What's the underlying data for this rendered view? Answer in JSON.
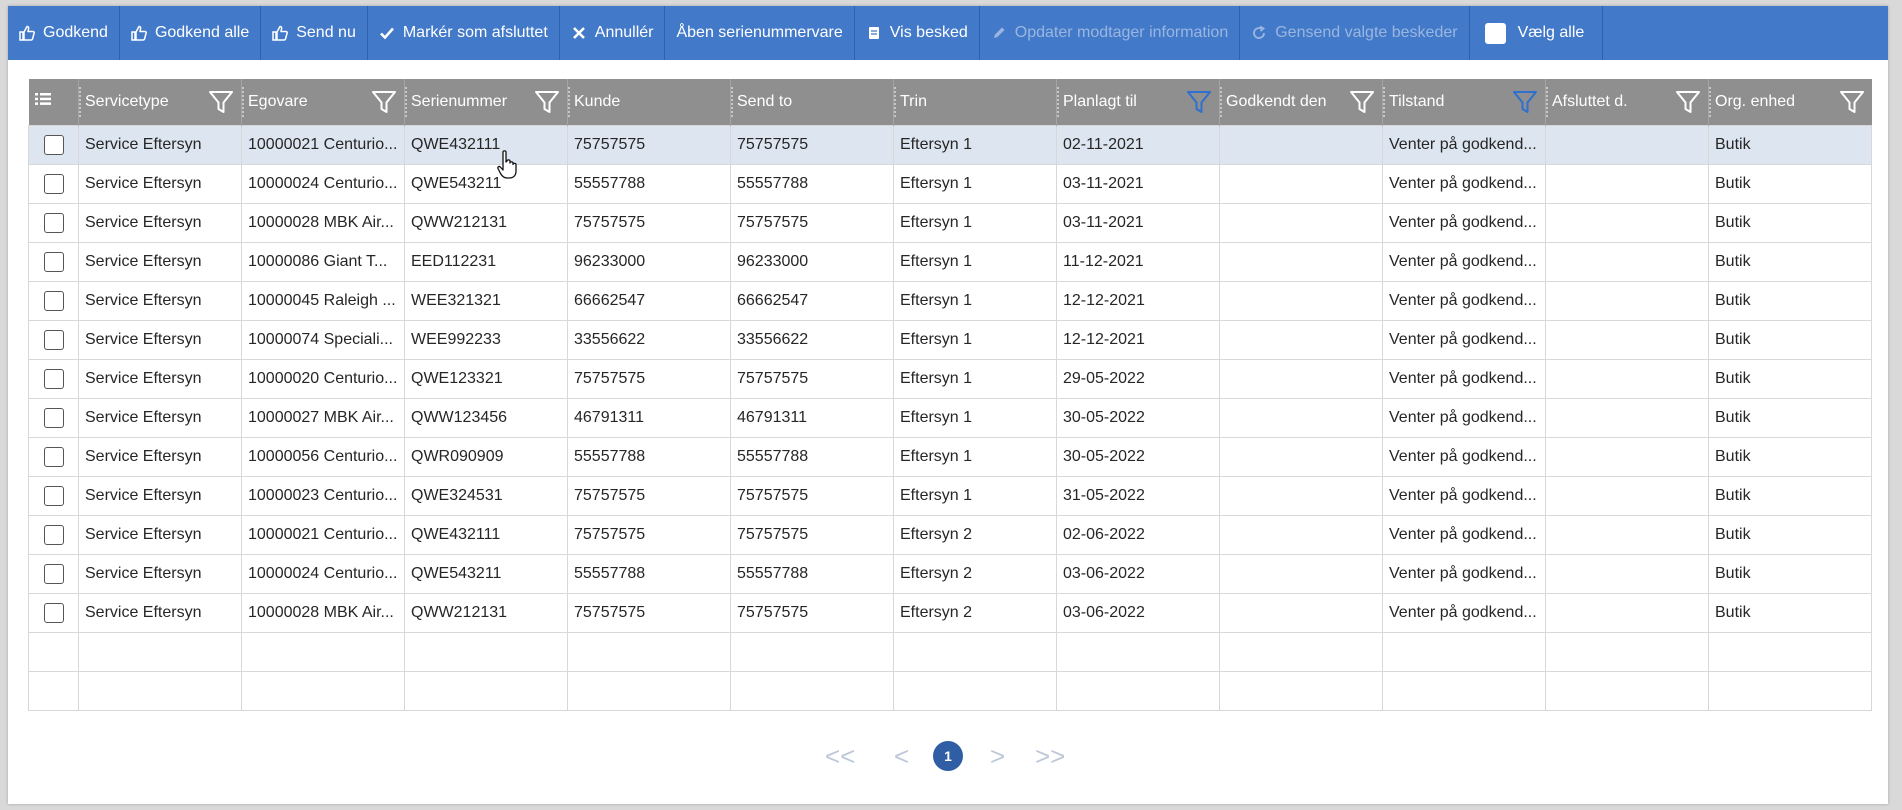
{
  "toolbar": {
    "buttons": [
      {
        "label": "Godkend",
        "icon": "thumbs-up-icon",
        "disabled": false
      },
      {
        "label": "Godkend alle",
        "icon": "thumbs-up-icon",
        "disabled": false
      },
      {
        "label": "Send nu",
        "icon": "thumbs-up-icon",
        "disabled": false
      },
      {
        "label": "Markér som afsluttet",
        "icon": "check-icon",
        "disabled": false
      },
      {
        "label": "Annullér",
        "icon": "x-icon",
        "disabled": false
      },
      {
        "label": "Åben serienummervare",
        "icon": "",
        "disabled": false
      },
      {
        "label": "Vis besked",
        "icon": "message-icon",
        "disabled": false
      },
      {
        "label": "Opdater modtager information",
        "icon": "pencil-icon",
        "disabled": true
      },
      {
        "label": "Gensend valgte beskeder",
        "icon": "refresh-icon",
        "disabled": true
      }
    ],
    "select_all_label": "Vælg alle"
  },
  "grid": {
    "columns": [
      {
        "label": "",
        "icon": "list-icon"
      },
      {
        "label": "Servicetype",
        "filter": true,
        "filter_active": false
      },
      {
        "label": "Egovare",
        "filter": true,
        "filter_active": false
      },
      {
        "label": "Serienummer",
        "filter": true,
        "filter_active": false
      },
      {
        "label": "Kunde",
        "filter": false
      },
      {
        "label": "Send to",
        "filter": false
      },
      {
        "label": "Trin",
        "filter": false
      },
      {
        "label": "Planlagt til",
        "filter": true,
        "filter_active": true
      },
      {
        "label": "Godkendt den",
        "filter": true,
        "filter_active": false
      },
      {
        "label": "Tilstand",
        "filter": true,
        "filter_active": true
      },
      {
        "label": "Afsluttet d.",
        "filter": true,
        "filter_active": false
      },
      {
        "label": "Org. enhed",
        "filter": true,
        "filter_active": false
      }
    ],
    "rows": [
      [
        "Service Eftersyn",
        "10000021 Centurio...",
        "QWE432111",
        "75757575",
        "75757575",
        "Eftersyn 1",
        "02-11-2021",
        "",
        "Venter på godkend...",
        "",
        "Butik"
      ],
      [
        "Service Eftersyn",
        "10000024 Centurio...",
        "QWE543211",
        "55557788",
        "55557788",
        "Eftersyn 1",
        "03-11-2021",
        "",
        "Venter på godkend...",
        "",
        "Butik"
      ],
      [
        "Service Eftersyn",
        "10000028 MBK Air...",
        "QWW212131",
        "75757575",
        "75757575",
        "Eftersyn 1",
        "03-11-2021",
        "",
        "Venter på godkend...",
        "",
        "Butik"
      ],
      [
        "Service Eftersyn",
        "10000086 Giant T...",
        "EED112231",
        "96233000",
        "96233000",
        "Eftersyn 1",
        "11-12-2021",
        "",
        "Venter på godkend...",
        "",
        "Butik"
      ],
      [
        "Service Eftersyn",
        "10000045 Raleigh ...",
        "WEE321321",
        "66662547",
        "66662547",
        "Eftersyn 1",
        "12-12-2021",
        "",
        "Venter på godkend...",
        "",
        "Butik"
      ],
      [
        "Service Eftersyn",
        "10000074 Speciali...",
        "WEE992233",
        "33556622",
        "33556622",
        "Eftersyn 1",
        "12-12-2021",
        "",
        "Venter på godkend...",
        "",
        "Butik"
      ],
      [
        "Service Eftersyn",
        "10000020 Centurio...",
        "QWE123321",
        "75757575",
        "75757575",
        "Eftersyn 1",
        "29-05-2022",
        "",
        "Venter på godkend...",
        "",
        "Butik"
      ],
      [
        "Service Eftersyn",
        "10000027 MBK Air...",
        "QWW123456",
        "46791311",
        "46791311",
        "Eftersyn 1",
        "30-05-2022",
        "",
        "Venter på godkend...",
        "",
        "Butik"
      ],
      [
        "Service Eftersyn",
        "10000056 Centurio...",
        "QWR090909",
        "55557788",
        "55557788",
        "Eftersyn 1",
        "30-05-2022",
        "",
        "Venter på godkend...",
        "",
        "Butik"
      ],
      [
        "Service Eftersyn",
        "10000023 Centurio...",
        "QWE324531",
        "75757575",
        "75757575",
        "Eftersyn 1",
        "31-05-2022",
        "",
        "Venter på godkend...",
        "",
        "Butik"
      ],
      [
        "Service Eftersyn",
        "10000021 Centurio...",
        "QWE432111",
        "75757575",
        "75757575",
        "Eftersyn 2",
        "02-06-2022",
        "",
        "Venter på godkend...",
        "",
        "Butik"
      ],
      [
        "Service Eftersyn",
        "10000024 Centurio...",
        "QWE543211",
        "55557788",
        "55557788",
        "Eftersyn 2",
        "03-06-2022",
        "",
        "Venter på godkend...",
        "",
        "Butik"
      ],
      [
        "Service Eftersyn",
        "10000028 MBK Air...",
        "QWW212131",
        "75757575",
        "75757575",
        "Eftersyn 2",
        "03-06-2022",
        "",
        "Venter på godkend...",
        "",
        "Butik"
      ]
    ],
    "empty_rows": 2,
    "selected_row": 0
  },
  "pager": {
    "first": "<<",
    "prev": "<",
    "current_page": "1",
    "next": ">",
    "last": ">>"
  },
  "colors": {
    "toolbar": "#4279c9",
    "header": "#8f8f8f",
    "selected_row": "#dde5f0",
    "filter_active": "#2f6fd0",
    "page_current": "#2f5ea5"
  }
}
